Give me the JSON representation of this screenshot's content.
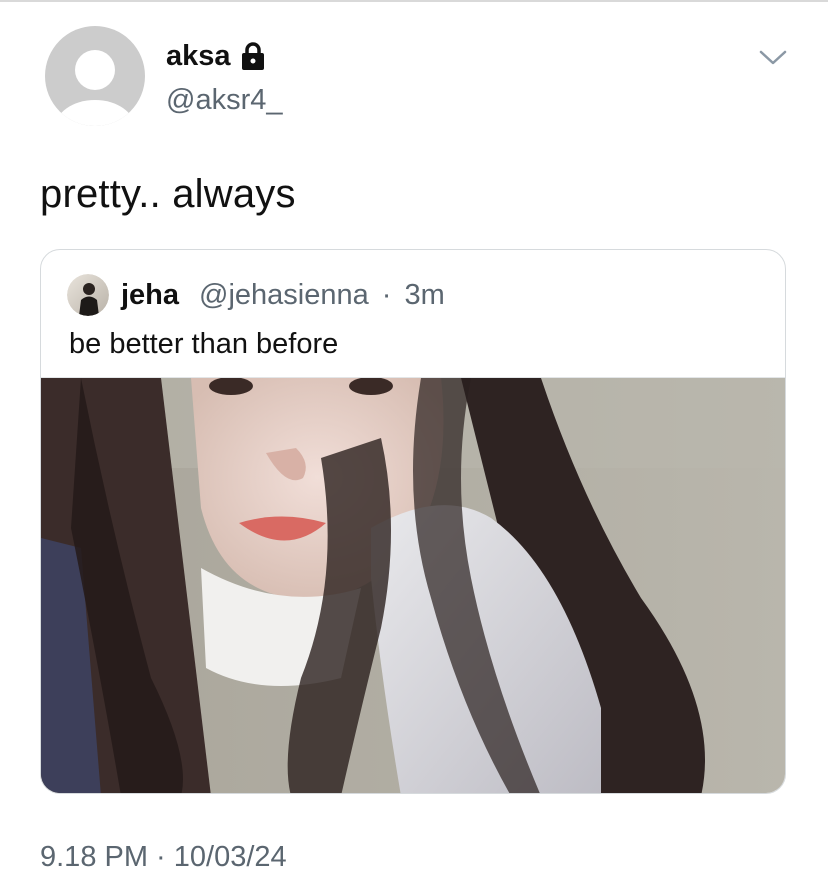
{
  "tweet": {
    "author": {
      "name": "aksa",
      "handle": "@aksr4_",
      "avatar_icon": "default-avatar-icon",
      "protected_icon": "lock-icon"
    },
    "text": "pretty.. always",
    "menu_icon": "chevron-down-icon",
    "timestamp": "9.18 PM · 10/03/24"
  },
  "quote": {
    "author": {
      "name": "jeha",
      "handle": "@jehasienna",
      "separator": "·",
      "time": "3m"
    },
    "text": "be better than before",
    "media": {
      "description_icon": "photo-icon"
    }
  },
  "colors": {
    "text_primary": "#111111",
    "text_secondary": "#5b6670",
    "border": "#d6dadd",
    "avatar_placeholder": "#cccccc"
  }
}
